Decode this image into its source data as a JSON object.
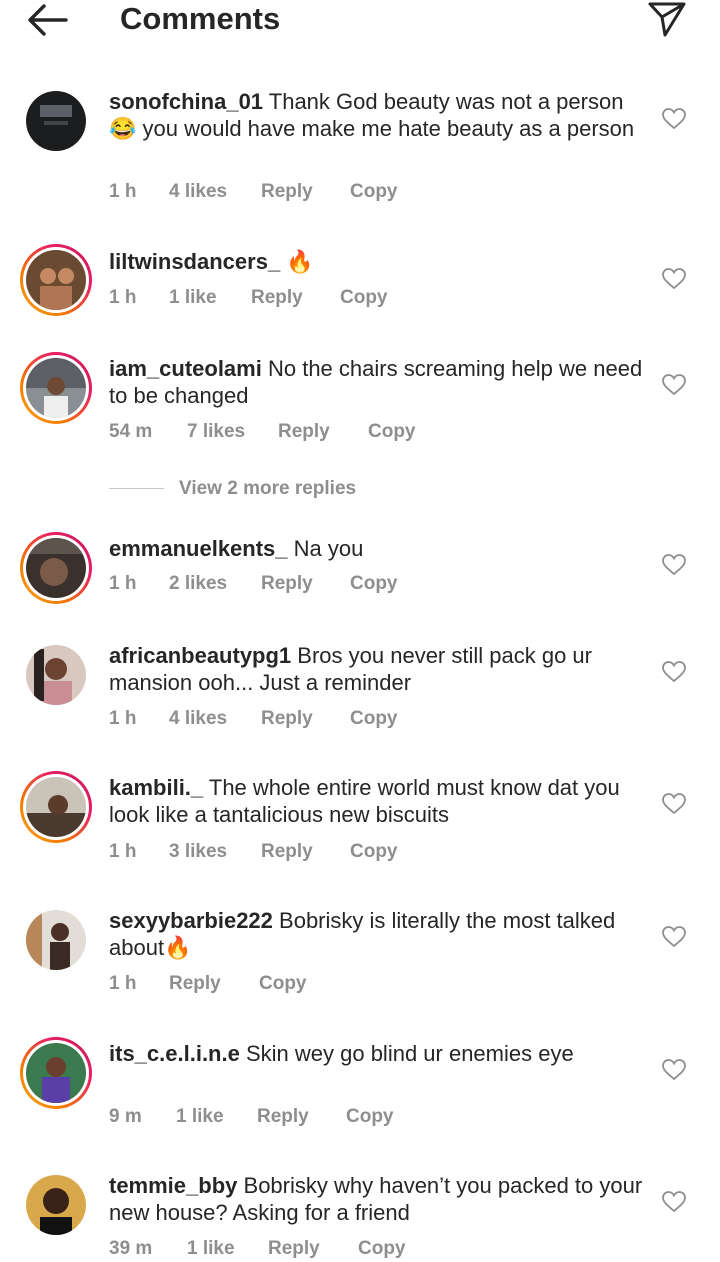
{
  "header": {
    "title": "Comments",
    "back_icon": "arrow-left-icon",
    "share_icon": "paper-plane-icon"
  },
  "colors": {
    "text": "#262626",
    "meta": "#8e8e8e",
    "story_ring": [
      "#f9a825",
      "#e91e63"
    ]
  },
  "comments": [
    {
      "username": "sonofchina_01",
      "text": "Thank God beauty was not a person 😂 you would have make me hate beauty as a person",
      "time": "1 h",
      "likes": "4 likes",
      "reply": "Reply",
      "copy": "Copy",
      "story_ring": false
    },
    {
      "username": "liltwinsdancers_",
      "text": "🔥",
      "time": "1 h",
      "likes": "1 like",
      "reply": "Reply",
      "copy": "Copy",
      "story_ring": true
    },
    {
      "username": "iam_cuteolami",
      "text": "No the chairs screaming help we need to be changed",
      "time": "54 m",
      "likes": "7 likes",
      "reply": "Reply",
      "copy": "Copy",
      "story_ring": true
    },
    {
      "username": "emmanuelkents_",
      "text": "Na you",
      "time": "1 h",
      "likes": "2 likes",
      "reply": "Reply",
      "copy": "Copy",
      "story_ring": true
    },
    {
      "username": "africanbeautypg1",
      "text": "Bros you never still pack go ur mansion ooh... Just a reminder",
      "time": "1 h",
      "likes": "4 likes",
      "reply": "Reply",
      "copy": "Copy",
      "story_ring": false
    },
    {
      "username": "kambili._",
      "text": "The whole entire world must know dat you look like a tantalicious new biscuits",
      "time": "1 h",
      "likes": "3 likes",
      "reply": "Reply",
      "copy": "Copy",
      "story_ring": true
    },
    {
      "username": "sexyybarbie222",
      "text": "Bobrisky is literally the most talked about🔥",
      "time": "1 h",
      "likes": "",
      "reply": "Reply",
      "copy": "Copy",
      "story_ring": false
    },
    {
      "username": "its_c.e.l.i.n.e",
      "text": "Skin wey go blind ur enemies eye",
      "time": "9 m",
      "likes": "1 like",
      "reply": "Reply",
      "copy": "Copy",
      "story_ring": true
    },
    {
      "username": "temmie_bby",
      "text": "Bobrisky why haven’t you packed to your new house? Asking for a friend",
      "time": "39 m",
      "likes": "1 like",
      "reply": "Reply",
      "copy": "Copy",
      "story_ring": false
    }
  ],
  "view_more": {
    "label": "View 2 more replies"
  }
}
